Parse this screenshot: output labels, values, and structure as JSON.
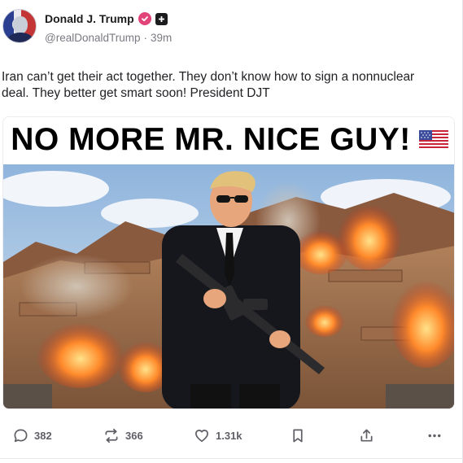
{
  "author": {
    "display_name": "Donald J. Trump",
    "handle": "@realDonaldTrump",
    "separator": "·",
    "timestamp": "39m"
  },
  "post": {
    "text": "Iran can’t get their act together. They don’t know how to sign a nonnuclear deal. They better get smart soon! President DJT",
    "image_headline": "NO MORE MR. NICE GUY!"
  },
  "actions": {
    "reply_count": "382",
    "repost_count": "366",
    "like_count": "1.31k"
  },
  "colors": {
    "verified_badge": "#e2447a",
    "text_secondary": "#7a7a82",
    "icon_gray": "#5f5f66"
  },
  "icons": [
    "verified-icon",
    "plus-icon",
    "reply-icon",
    "repost-icon",
    "like-icon",
    "bookmark-icon",
    "share-icon",
    "more-icon",
    "us-flag-icon"
  ]
}
